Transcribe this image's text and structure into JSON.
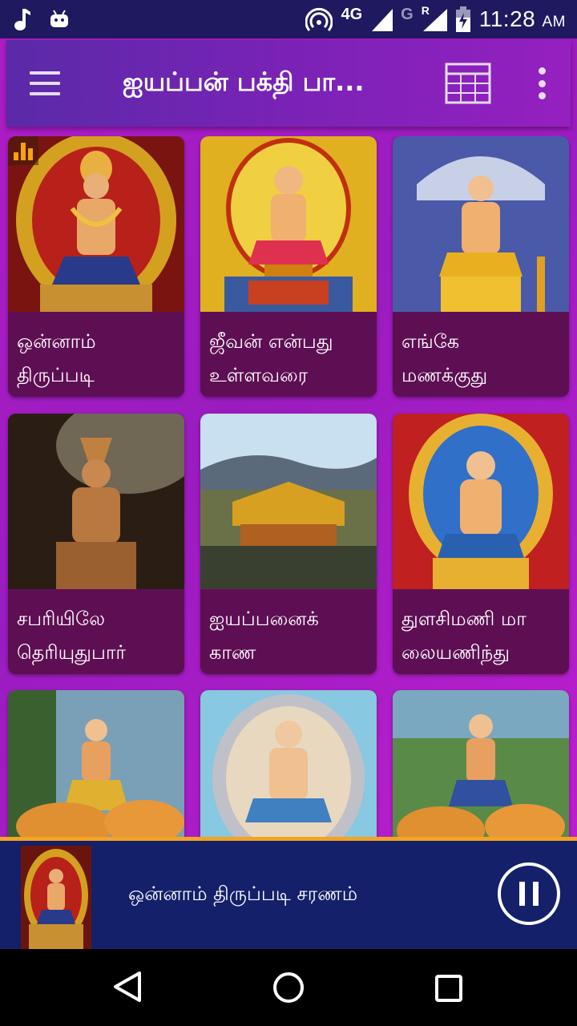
{
  "status_bar": {
    "network": "4G",
    "roaming_network": "G",
    "roaming_indicator": "R",
    "time": "11:28",
    "ampm": "AM",
    "icons": [
      "music-note-icon",
      "android-icon",
      "hotspot-icon",
      "signal-icon",
      "battery-charging-icon"
    ]
  },
  "app_bar": {
    "title": "ஐயப்பன் பக்தி பா...",
    "menu_icon": "hamburger-menu-icon",
    "calendar_icon": "calendar-icon",
    "overflow_icon": "more-vert-icon"
  },
  "songs": [
    {
      "title_line1": "ஒன்னாம்",
      "title_line2": "திருப்படி",
      "playing": true
    },
    {
      "title_line1": "ஜீவன் என்பது",
      "title_line2": "உள்ளவரை",
      "playing": false
    },
    {
      "title_line1": "எங்கே",
      "title_line2": "மணக்குது",
      "playing": false
    },
    {
      "title_line1": "சபரியிலே",
      "title_line2": "தெரியுதுபார்",
      "playing": false
    },
    {
      "title_line1": "ஐயப்பனைக்",
      "title_line2": "காண",
      "playing": false
    },
    {
      "title_line1": "துளசிமணி மா",
      "title_line2": "லையணிந்து",
      "playing": false
    },
    {
      "title_line1": "",
      "title_line2": "",
      "playing": false
    },
    {
      "title_line1": "",
      "title_line2": "",
      "playing": false
    },
    {
      "title_line1": "",
      "title_line2": "",
      "playing": false
    }
  ],
  "player": {
    "now_playing": "ஒன்னாம் திருப்படி சரணம்",
    "control_icon": "pause-icon"
  },
  "colors": {
    "status_bar": "#1f1960",
    "app_bar": "#7a22b6",
    "card_label": "#5e0f54",
    "player_bar": "#14206a",
    "accent": "#f4a321"
  }
}
